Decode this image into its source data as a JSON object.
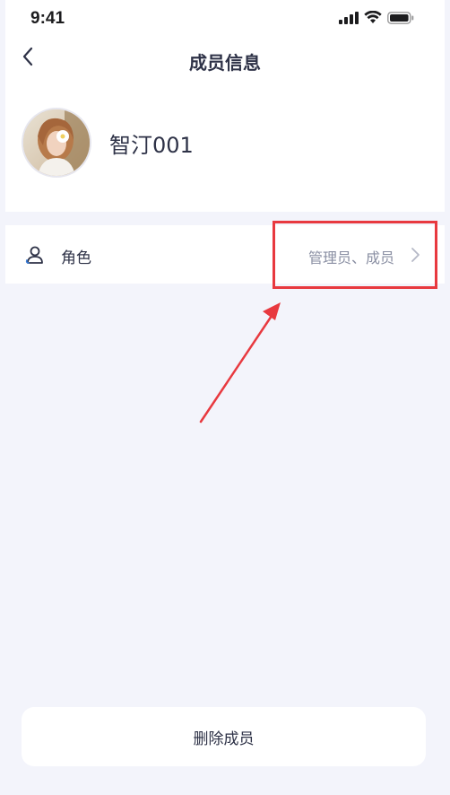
{
  "status_bar": {
    "time": "9:41",
    "icons": [
      "cellular-signal-icon",
      "wifi-icon",
      "battery-icon"
    ]
  },
  "nav": {
    "title": "成员信息",
    "back_icon": "chevron-left-icon"
  },
  "member": {
    "name": "智汀001",
    "avatar_icon": "avatar-photo"
  },
  "role_row": {
    "icon": "user-outline-icon",
    "label": "角色",
    "value": "管理员、成员",
    "chevron_icon": "chevron-right-icon"
  },
  "actions": {
    "delete_label": "删除成员"
  },
  "annotation": {
    "highlight_color": "#e8393f"
  },
  "colors": {
    "background": "#f3f4fb",
    "card": "#ffffff",
    "text_primary": "#2e3247",
    "text_secondary": "#8a8fa3",
    "annotation": "#e8393f"
  }
}
